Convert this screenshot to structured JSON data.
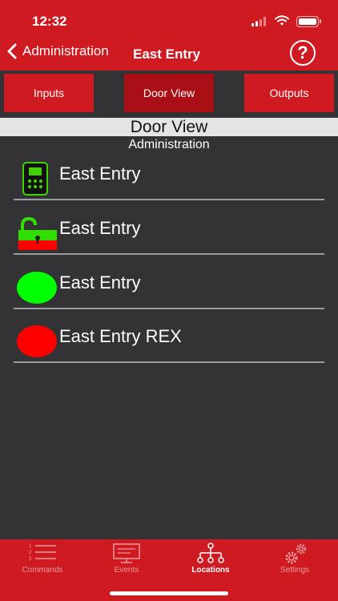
{
  "status": {
    "time": "12:32"
  },
  "nav": {
    "back_label": "Administration",
    "title": "East Entry",
    "help_glyph": "?"
  },
  "tabs": [
    {
      "label": "Inputs",
      "active": false
    },
    {
      "label": "Door View",
      "active": true
    },
    {
      "label": "Outputs",
      "active": false
    }
  ],
  "section": {
    "title": "Door View",
    "subtitle": "Administration"
  },
  "rows": [
    {
      "label": "East Entry",
      "icon": "keypad-reader-icon"
    },
    {
      "label": "East Entry",
      "icon": "unlocked-padlock-icon"
    },
    {
      "label": "East Entry",
      "icon": "green-status-icon"
    },
    {
      "label": "East Entry REX",
      "icon": "red-status-icon"
    }
  ],
  "tabbar": [
    {
      "label": "Commands",
      "icon": "commands-list-icon",
      "active": false
    },
    {
      "label": "Events",
      "icon": "events-monitor-icon",
      "active": false
    },
    {
      "label": "Locations",
      "icon": "locations-tree-icon",
      "active": true
    },
    {
      "label": "Settings",
      "icon": "settings-gears-icon",
      "active": false
    }
  ],
  "colors": {
    "brand": "#cf1a22",
    "active_tab": "#a90f14",
    "background": "#333335",
    "status_green": "#00ff00",
    "status_red": "#ff0000"
  }
}
